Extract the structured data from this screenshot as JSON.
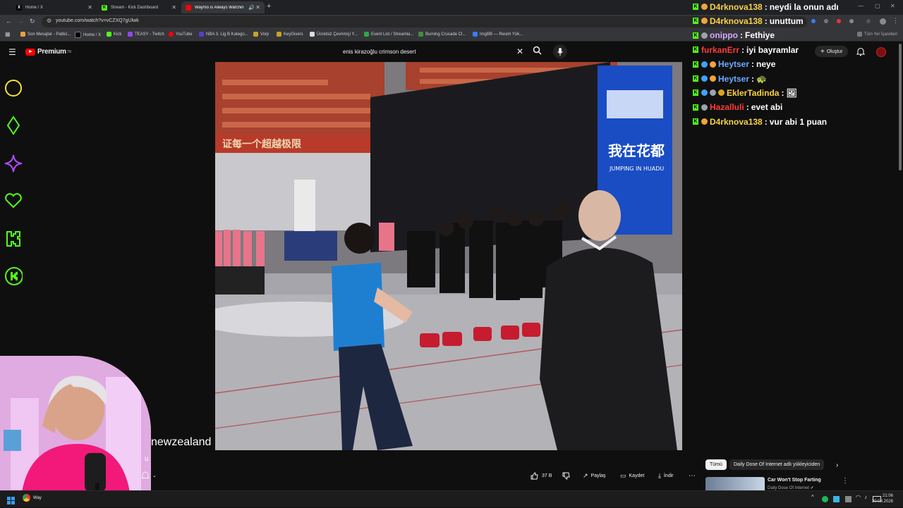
{
  "browser": {
    "tabs": [
      {
        "label": "Home / X",
        "active": false
      },
      {
        "label": "Stream - Kick Dashboard",
        "active": false
      },
      {
        "label": "Waymo is Always Watchin...",
        "active": true
      }
    ],
    "url": "youtube.com/watch?v=vCZXQ7gUlwk",
    "bookmarks": [
      "Son Mesajlar - Patlici...",
      "Home / X",
      "Kick",
      "TEASY - Twitch",
      "YouTube",
      "NBA 3. Lig B Katego...",
      "Vorp",
      "KeyGivers",
      "Ücretsiz Çevrimiçi Y...",
      "Event List / Streamla...",
      "Burning Crusade Cl...",
      "ImgBB — Resim Yük..."
    ],
    "other_bookmarks": "Tüm Yer İşaretleri"
  },
  "youtube": {
    "logo_text": "Premium",
    "logo_region": "TR",
    "search_query": "enis kirazoğlu crimson desert",
    "create_label": "Oluştur"
  },
  "video": {
    "banner_text": "我在花都",
    "banner_subtext": "JUMPING IN HUADU",
    "wall_text": "证每一个超越极限"
  },
  "captions": {
    "line1": "newzealand",
    "line2": "u"
  },
  "chat": [
    {
      "user": "D4rknova138",
      "message": "neydi la onun adı",
      "color": "#f7d24b",
      "badges": [
        "kick",
        "gift"
      ]
    },
    {
      "user": "D4rknova138",
      "message": "unuttum",
      "color": "#f7d24b",
      "badges": [
        "kick",
        "gift"
      ]
    },
    {
      "user": "onippo",
      "message": "Fethiye",
      "color": "#d8a8ff",
      "badges": [
        "kick",
        "cap"
      ]
    },
    {
      "user": "furkanErr",
      "message": "iyi bayramlar",
      "color": "#ff3b3b",
      "badges": [
        "kick"
      ]
    },
    {
      "user": "Heytser",
      "message": "neye",
      "color": "#6aa9ff",
      "badges": [
        "kick",
        "diamond",
        "gift"
      ]
    },
    {
      "user": "Heytser",
      "message": "🐢",
      "color": "#6aa9ff",
      "badges": [
        "kick",
        "diamond",
        "gift"
      ]
    },
    {
      "user": "EklerTadinda",
      "message": "🖼",
      "color": "#ffd23b",
      "badges": [
        "kick",
        "diamond",
        "cap",
        "crown"
      ]
    },
    {
      "user": "Hazalluli",
      "message": "evet abi",
      "color": "#ff3b3b",
      "badges": [
        "kick",
        "cap"
      ]
    },
    {
      "user": "D4rknova138",
      "message": "vur abi 1 puan",
      "color": "#f7d24b",
      "badges": [
        "kick",
        "gift"
      ]
    }
  ],
  "actions": {
    "likes": "37 B",
    "share": "Paylaş",
    "save": "Kaydet",
    "download": "İndir"
  },
  "recommendations": {
    "chips": [
      "Tümü",
      "Daily Dose Of Internet adlı yükleyiciden"
    ],
    "first_title": "Car Won't Stop Farting",
    "first_channel": "Daily Dose Of Internet"
  },
  "taskbar": {
    "app_label": "Way",
    "time": "21:06",
    "date": "20.03.2026"
  },
  "colors": {
    "kick_green": "#53fc18",
    "yt_red": "#ff0000",
    "bg": "#0f0f0f"
  }
}
